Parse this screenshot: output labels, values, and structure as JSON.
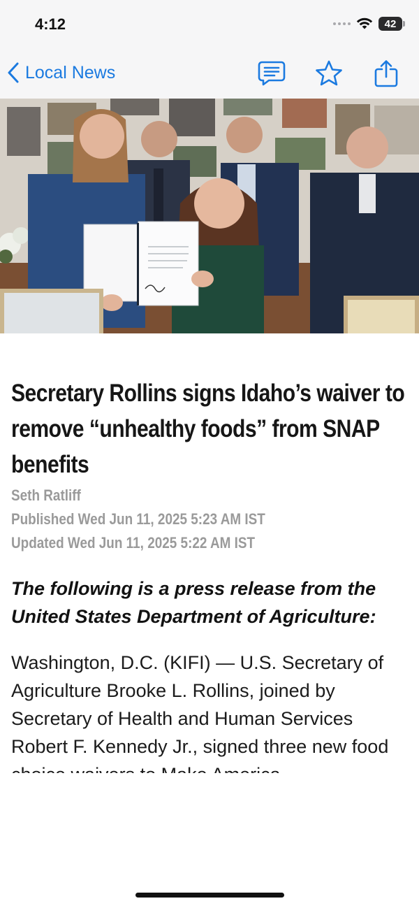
{
  "status_bar": {
    "time": "4:12",
    "battery_level": "42"
  },
  "nav": {
    "back_label": "Local News",
    "icons": [
      "chevron-left-icon",
      "comment-icon",
      "star-icon",
      "share-icon"
    ],
    "accent_color": "#1b7ae0"
  },
  "article": {
    "headline": "Secretary Rollins signs Idaho’s waiver to remove “unhealthy foods” from SNAP benefits",
    "author": "Seth Ratliff",
    "published": "Published Wed Jun 11, 2025 5:23 AM IST",
    "updated": "Updated Wed Jun 11, 2025 5:22 AM IST",
    "intro": "The following is a press release from the United States Department of Agriculture:",
    "body": "Washington, D.C. (KIFI) — U.S. Secretary of Agriculture Brooke L. Rollins, joined by Secretary of Health and Human Services Robert F. Kennedy Jr., signed three new food choice waivers to Make America"
  }
}
